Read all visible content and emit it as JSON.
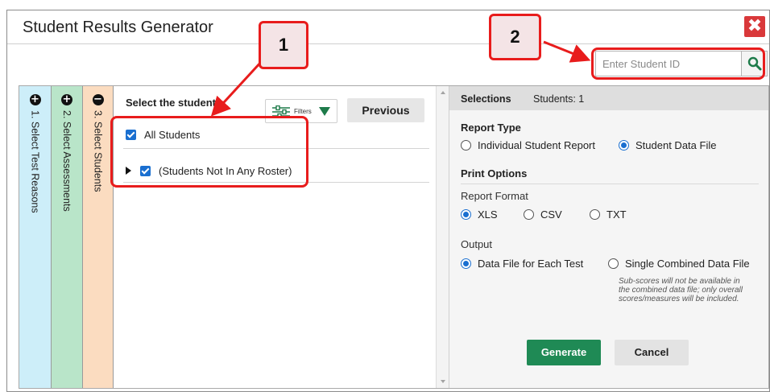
{
  "dialog": {
    "title": "Student Results Generator",
    "close_glyph": "✖"
  },
  "search": {
    "placeholder": "Enter Student ID",
    "icon": "search-icon"
  },
  "steps": [
    {
      "label": "1. Select Test Reasons",
      "icon": "plus-circle-icon",
      "glyph": "+",
      "color": "#cdeef9"
    },
    {
      "label": "2. Select Assessments",
      "icon": "plus-circle-icon",
      "glyph": "+",
      "color": "#b9e5c9"
    },
    {
      "label": "3. Select Students",
      "icon": "minus-circle-icon",
      "glyph": "−",
      "color": "#fbdcc0"
    }
  ],
  "students": {
    "heading": "Select the students",
    "filters_label": "Filters",
    "previous_label": "Previous",
    "all_label": "All Students",
    "roster_label": "(Students Not In Any Roster)"
  },
  "options": {
    "header_title": "Selections",
    "header_count": "Students: 1",
    "report_type": {
      "heading": "Report Type",
      "choices": [
        "Individual Student Report",
        "Student Data File"
      ],
      "selected": "Student Data File"
    },
    "print_options": {
      "heading": "Print Options",
      "format_label": "Report Format",
      "formats": [
        "XLS",
        "CSV",
        "TXT"
      ],
      "selected_format": "XLS",
      "output_label": "Output",
      "outputs": [
        "Data File for Each Test",
        "Single Combined Data File"
      ],
      "selected_output": "Data File for Each Test",
      "note": "Sub-scores will not be available in the combined data file; only overall scores/measures will be included."
    },
    "generate_label": "Generate",
    "cancel_label": "Cancel"
  },
  "callouts": [
    "1",
    "2"
  ],
  "colors": {
    "accent_blue": "#1a6fd0",
    "generate_green": "#1f8a55",
    "close_red": "#d9383a",
    "callout_red": "#e81c1c",
    "callout_fill": "#f4e4e6"
  }
}
